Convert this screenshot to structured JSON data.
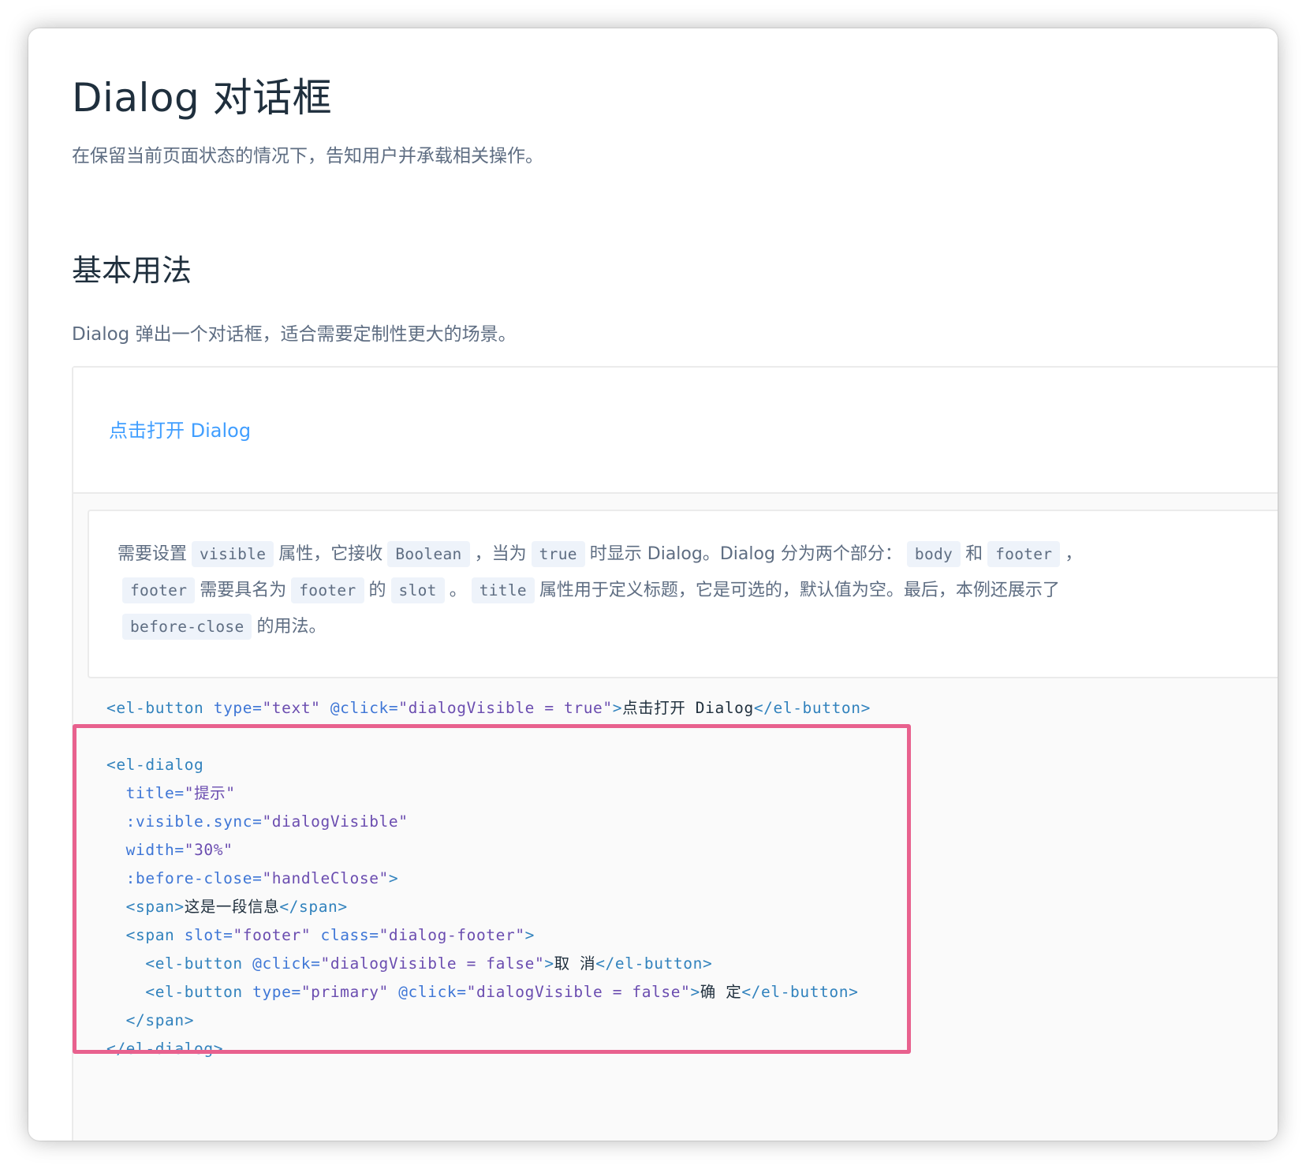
{
  "page": {
    "title": "Dialog 对话框",
    "description": "在保留当前页面状态的情况下，告知用户并承载相关操作。"
  },
  "section": {
    "title": "基本用法",
    "description": "Dialog 弹出一个对话框，适合需要定制性更大的场景。"
  },
  "demo": {
    "open_button_label": "点击打开 Dialog",
    "description": {
      "p1": "需要设置",
      "c1": "visible",
      "p2": "属性，它接收",
      "c2": "Boolean",
      "p3": "，当为",
      "c3": "true",
      "p4": "时显示 Dialog。Dialog 分为两个部分：",
      "c4": "body",
      "p5": "和",
      "c5": "footer",
      "p6": "，",
      "c6": "footer",
      "p7": "需要具名为",
      "c7": "footer",
      "p8": "的",
      "c8": "slot",
      "p9": "。",
      "c9": "title",
      "p10": "属性用于定义标题，它是可选的，默认值为空。最后，本例还展示了",
      "c10": "before-close",
      "p11": "的用法。"
    },
    "code": {
      "l1_open": "<el-button",
      "l1_attr1": " type=",
      "l1_val1": "\"text\"",
      "l1_attr2": " @click=",
      "l1_val2": "\"dialogVisible = true\"",
      "l1_gt": ">",
      "l1_text": "点击打开 Dialog",
      "l1_close": "</el-button>",
      "l2": "<el-dialog",
      "l3_attr": "  title=",
      "l3_val": "\"提示\"",
      "l4_attr": "  :visible.sync=",
      "l4_val": "\"dialogVisible\"",
      "l5_attr": "  width=",
      "l5_val": "\"30%\"",
      "l6_attr": "  :before-close=",
      "l6_val": "\"handleClose\"",
      "l6_gt": ">",
      "l7_open": "  <span>",
      "l7_text": "这是一段信息",
      "l7_close": "</span>",
      "l8_open": "  <span",
      "l8_attr1": " slot=",
      "l8_val1": "\"footer\"",
      "l8_attr2": " class=",
      "l8_val2": "\"dialog-footer\"",
      "l8_gt": ">",
      "l9_open": "    <el-button",
      "l9_attr": " @click=",
      "l9_val": "\"dialogVisible = false\"",
      "l9_gt": ">",
      "l9_text": "取 消",
      "l9_close": "</el-button>",
      "l10_open": "    <el-button",
      "l10_attr1": " type=",
      "l10_val1": "\"primary\"",
      "l10_attr2": " @click=",
      "l10_val2": "\"dialogVisible = false\"",
      "l10_gt": ">",
      "l10_text": "确 定",
      "l10_close": "</el-button>",
      "l11": "  </span>",
      "l12": "</el-dialog>"
    }
  },
  "colors": {
    "link": "#409eff",
    "highlight_border": "#e8618e",
    "tag": "#3182bd",
    "string": "#6b4db0"
  }
}
